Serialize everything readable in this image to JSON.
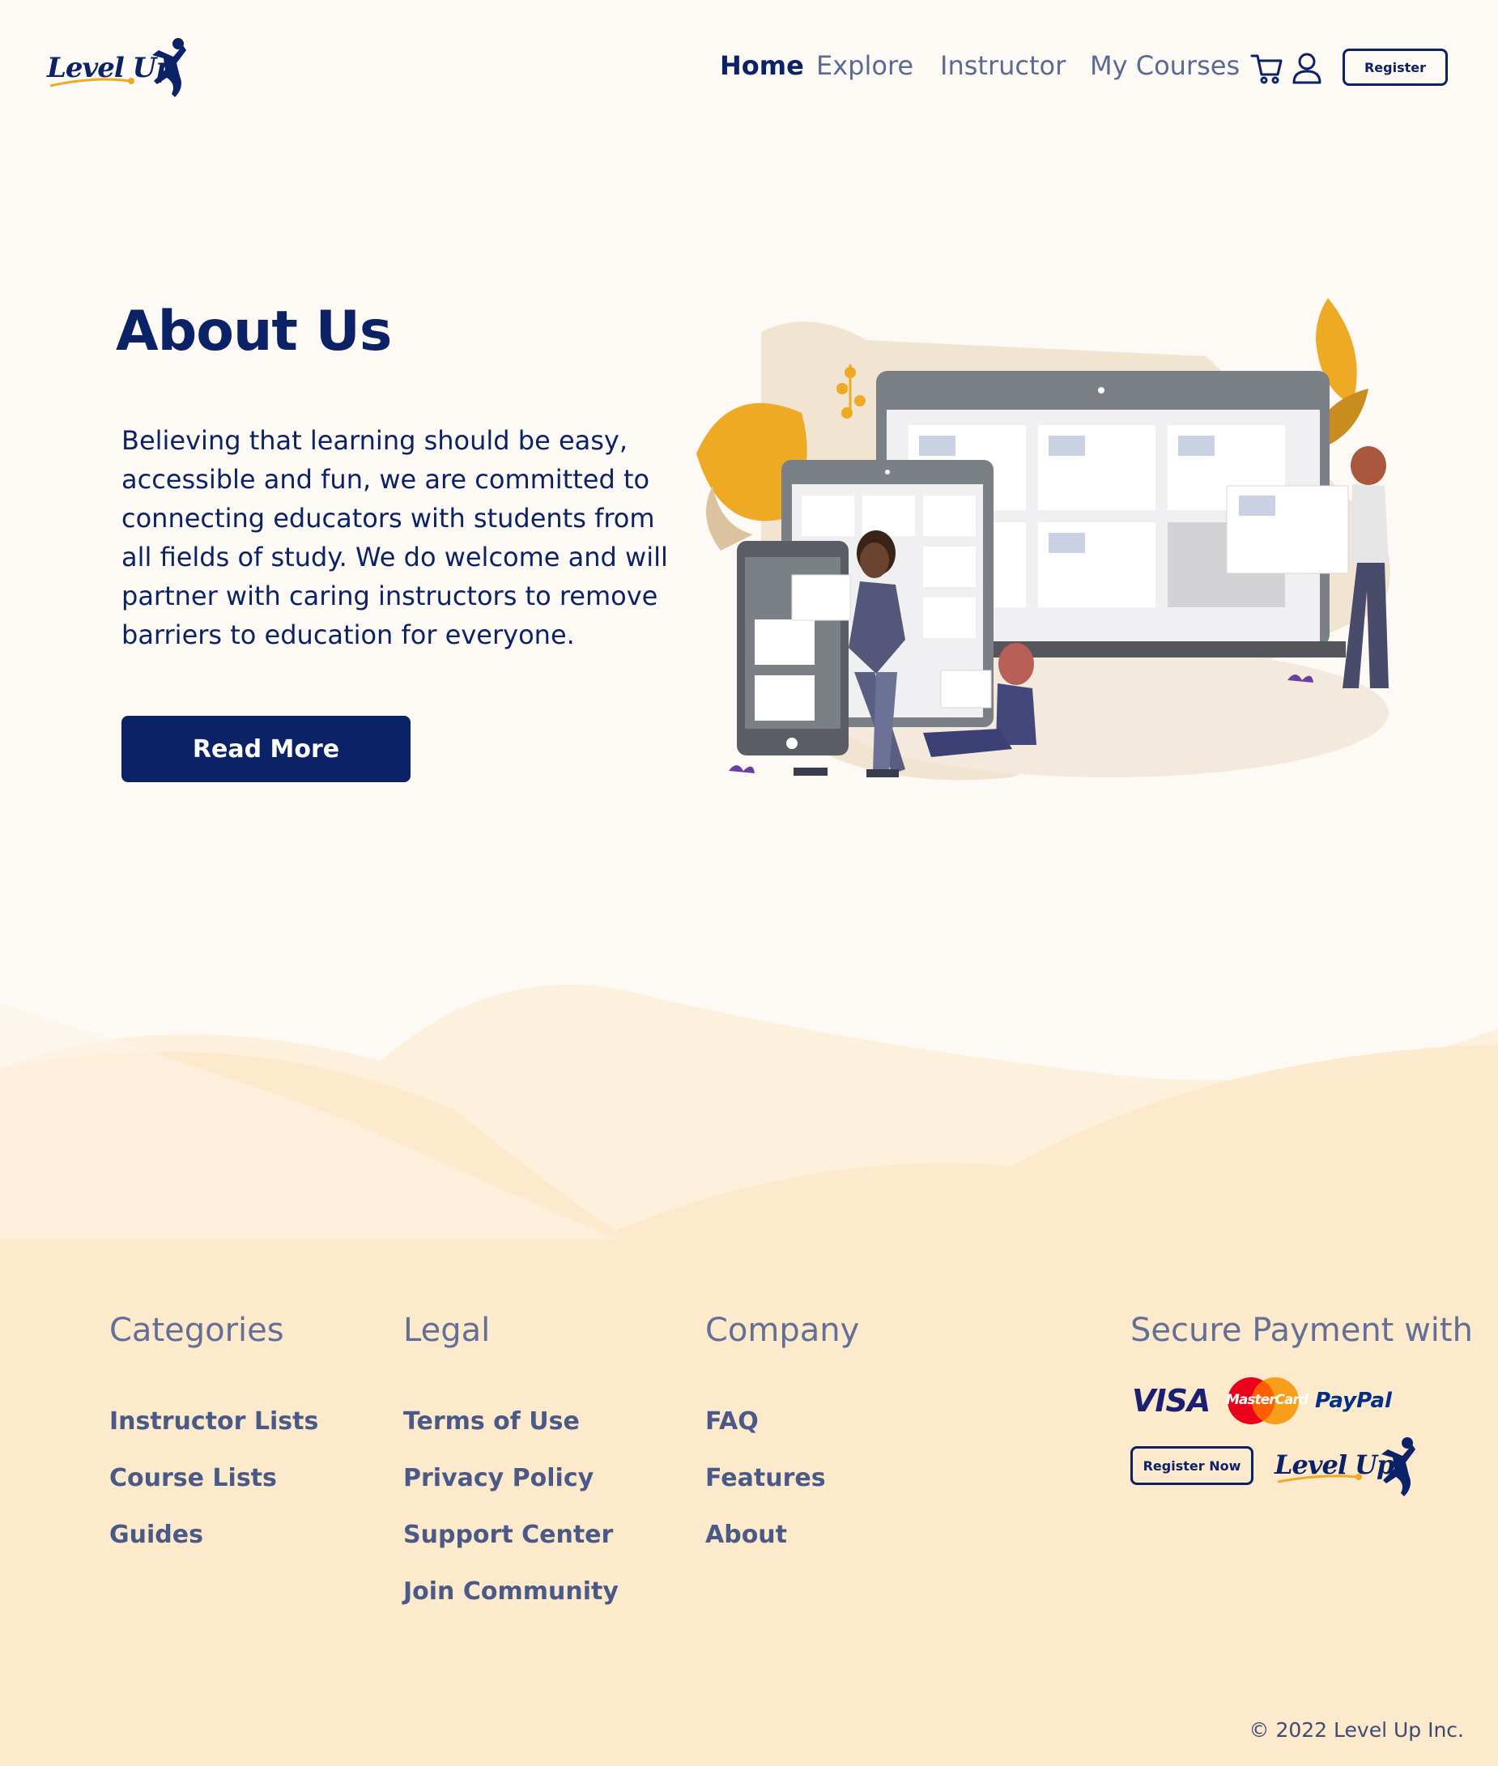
{
  "brand": {
    "name": "Level Up"
  },
  "nav": {
    "items": [
      {
        "label": "Home",
        "active": true
      },
      {
        "label": "Explore",
        "active": false
      },
      {
        "label": "Instructor",
        "active": false
      },
      {
        "label": "My Courses",
        "active": false
      }
    ],
    "cart_icon": "shopping-cart-icon",
    "user_icon": "user-icon",
    "register_label": "Register"
  },
  "hero": {
    "title": "About Us",
    "body": "Believing that learning should be easy, accessible and fun, we are committed to connecting educators with students from all fields of study. We do welcome and will partner with caring instructors to remove barriers to education for everyone.",
    "cta_label": "Read More"
  },
  "footer": {
    "categories": {
      "heading": "Categories",
      "links": [
        "Instructor Lists",
        "Course Lists",
        "Guides"
      ]
    },
    "legal": {
      "heading": "Legal",
      "links": [
        "Terms of Use",
        "Privacy Policy",
        "Support Center",
        "Join Community"
      ]
    },
    "company": {
      "heading": "Company",
      "links": [
        "FAQ",
        "Features",
        "About"
      ]
    },
    "payment": {
      "heading": "Secure Payment with",
      "visa": "VISA",
      "mastercard": "MasterCard",
      "paypal": "PayPal",
      "register_label": "Register Now"
    },
    "copyright": "© 2022 Level Up Inc."
  },
  "colors": {
    "primary": "#0b2266",
    "background": "#fdf9f4",
    "footer_bg": "#fde9cc",
    "accent_orange": "#eeaa24",
    "muted_text": "#5b6a93"
  }
}
